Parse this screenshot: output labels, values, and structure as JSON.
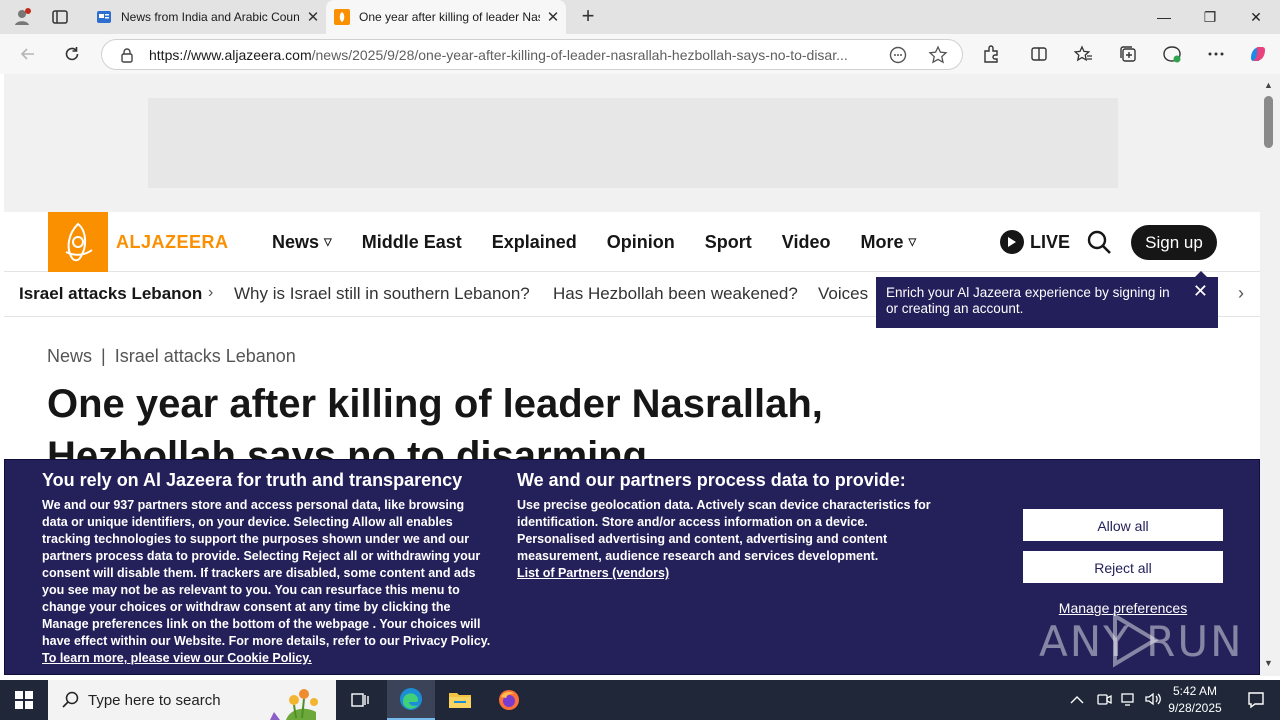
{
  "browser": {
    "tabs": [
      {
        "title": "News from India and Arabic Countries",
        "active": false
      },
      {
        "title": "One year after killing of leader Nasrallah",
        "active": true
      }
    ],
    "new_tab": "+",
    "url_host": "https://www.aljazeera.com",
    "url_path": "/news/2025/9/28/one-year-after-killing-of-leader-nasrallah-hezbollah-says-no-to-disar...",
    "window_controls": {
      "minimize": "—",
      "restore": "❐",
      "close": "✕"
    }
  },
  "site": {
    "logo_text": "ALJAZEERA",
    "brand_color": "#fa9000",
    "nav": [
      {
        "label": "News",
        "has_menu": true
      },
      {
        "label": "Middle East",
        "has_menu": false
      },
      {
        "label": "Explained",
        "has_menu": false
      },
      {
        "label": "Opinion",
        "has_menu": false
      },
      {
        "label": "Sport",
        "has_menu": false
      },
      {
        "label": "Video",
        "has_menu": false
      },
      {
        "label": "More",
        "has_menu": true
      }
    ],
    "live_label": "LIVE",
    "signup_label": "Sign up",
    "subnav": {
      "topic": "Israel attacks Lebanon",
      "links": [
        "Why is Israel still in southern Lebanon?",
        "Has Hezbollah been weakened?",
        "Voices"
      ]
    },
    "tooltip": "Enrich your Al Jazeera experience by signing in or creating an account."
  },
  "article": {
    "breadcrumb": [
      "News",
      "Israel attacks Lebanon"
    ],
    "headline": "One year after killing of leader Nasrallah, Hezbollah says no to disarming"
  },
  "consent": {
    "left_title": "You rely on Al Jazeera for truth and transparency",
    "left_body_1": "We and our ",
    "partners_count": "937",
    "left_body_2": " partners store and access personal data, like browsing data or unique identifiers, on your device. Selecting Allow all enables tracking technologies to support the purposes shown under we and our partners process data to provide. Selecting Reject all or withdrawing your consent will disable them. If trackers are disabled, some content and ads you see may not be as relevant to you. You can resurface this menu to change your choices or withdraw consent at any time by clicking the Manage preferences link on the bottom of the webpage . Your choices will have effect within our Website. For more details, refer to our Privacy Policy.  ",
    "cookie_link": "To learn more, please view our Cookie Policy.",
    "mid_title": "We and our partners process data to provide:",
    "mid_body": "Use precise geolocation data. Actively scan device characteristics for identification. Store and/or access information on a device. Personalised advertising and content, advertising and content measurement, audience research and services development.",
    "partners_link": "List of Partners (vendors)",
    "allow_all": "Allow all",
    "reject_all": "Reject all",
    "manage_prefs": "Manage preferences",
    "bg_color": "#24215a"
  },
  "watermark": "ANY RUN",
  "taskbar": {
    "search_placeholder": "Type here to search",
    "time": "5:42 AM",
    "date": "9/28/2025"
  }
}
